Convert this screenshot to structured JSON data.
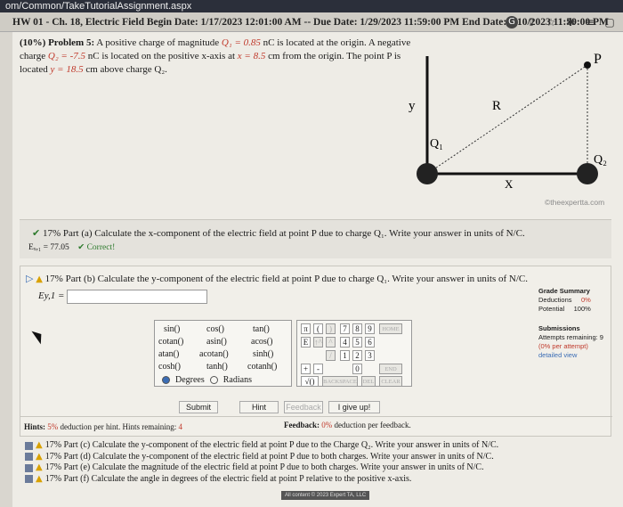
{
  "browser": {
    "url": "om/Common/TakeTutorialAssignment.aspx"
  },
  "header": {
    "title": "HW 01 - Ch. 18, Electric Field Begin Date: 1/17/2023 12:01:00 AM -- Due Date: 1/29/2023 11:59:00 PM End Date: 5/10/2023 11:59:00 PM"
  },
  "problem": {
    "prefix": "(10%) Problem 5:",
    "text1": "A positive charge of magnitude ",
    "q1": "Q₁ = 0.85",
    "text2": " nC is located at the origin. A negative charge ",
    "q2": "Q₂ = -7.5",
    "text3": " nC is located on the positive x-axis at ",
    "xval": "x = 8.5",
    "text4": " cm from the origin. The point P is located ",
    "yval": "y = 18.5",
    "text5": " cm above charge Q₂."
  },
  "diagram": {
    "y": "y",
    "R": "R",
    "x": "X",
    "P": "P",
    "Q1": "Q₁",
    "Q2": "Q₂"
  },
  "watermark": "©theexpertta.com",
  "partA": {
    "question": "17% Part (a)  Calculate the x-component of the electric field at point P due to charge Q₁. Write your answer in units of N/C.",
    "answer": "Eₓ,₁ = 77.05",
    "status": "Correct!"
  },
  "partB": {
    "question": "17% Part (b)  Calculate the y-component of the electric field at point P due to charge Q₁. Write your answer in units of N/C.",
    "label": "Ey,1 =",
    "value": ""
  },
  "keypad": {
    "funcs": [
      "sin()",
      "cos()",
      "tan()",
      "cotan()",
      "asin()",
      "acos()",
      "atan()",
      "acotan()",
      "sinh()",
      "cosh()",
      "tanh()",
      "cotanh()"
    ],
    "degrees": "Degrees",
    "radians": "Radians",
    "sym": [
      "π",
      "(",
      "E",
      "↑^",
      "^",
      "/",
      "+",
      "-",
      "√()"
    ],
    "digits": [
      "7",
      "8",
      "9",
      "4",
      "5",
      "6",
      "1",
      "2",
      "3",
      "0"
    ],
    "home": "HOME",
    "end": "END",
    "backspace": "BACKSPACE",
    "del": "DEL",
    "clear": "CLEAR"
  },
  "buttons": {
    "submit": "Submit",
    "hint": "Hint",
    "feedback": "Feedback",
    "give_up": "I give up!"
  },
  "hints": {
    "label": "Hints:",
    "pct": "5%",
    "text": " deduction per hint. Hints remaining:",
    "remaining": "4"
  },
  "feedback": {
    "label": "Feedback:",
    "pct": "0%",
    "text": " deduction per feedback."
  },
  "grade": {
    "title": "Grade Summary",
    "deductions_label": "Deductions",
    "deductions": "0%",
    "potential_label": "Potential",
    "potential": "100%",
    "subs_title": "Submissions",
    "attempts": "Attempts remaining: 9",
    "per_attempt": "(0% per attempt)",
    "detailed": "detailed view"
  },
  "later_parts": [
    "17% Part (c)  Calculate the y-component of the electric field at point P due to the Charge Q₂. Write your answer in units of N/C.",
    "17% Part (d)  Calculate the y-component of the electric field at point P due to both charges. Write your answer in units of N/C.",
    "17% Part (e)  Calculate the magnitude of the electric field at point P due to both charges. Write your answer in units of N/C.",
    "17% Part (f)  Calculate the angle in degrees of the electric field at point P relative to the positive x-axis."
  ],
  "footer": "All content © 2023 Expert TA, LLC",
  "icons": [
    "g-circle-icon",
    "share-icon",
    "star-icon",
    "puzzle-icon",
    "menu-icon",
    "window-icon"
  ]
}
